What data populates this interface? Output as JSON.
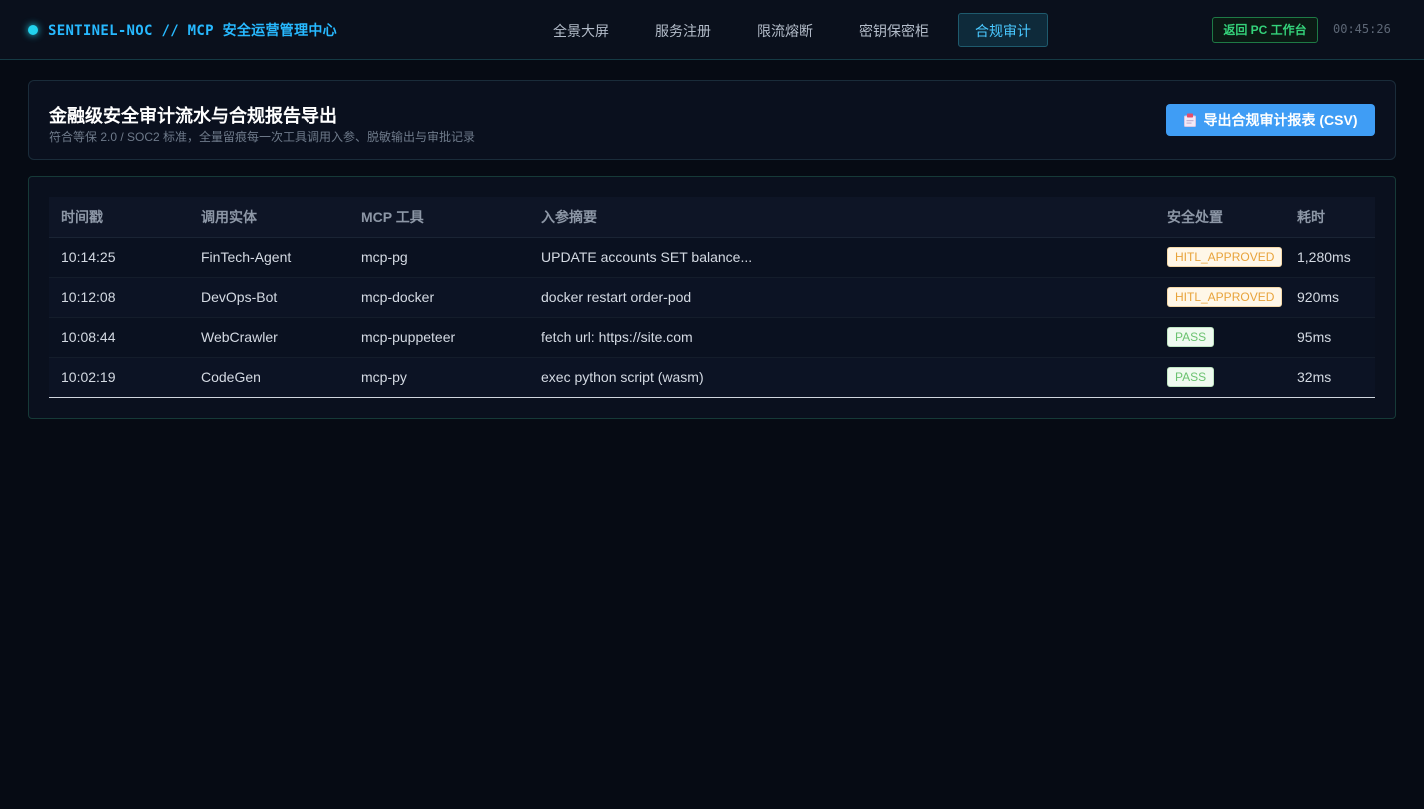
{
  "header": {
    "brand": "SENTINEL-NOC // MCP 安全运营管理中心",
    "nav": [
      "全景大屏",
      "服务注册",
      "限流熔断",
      "密钥保密柜",
      "合规审计"
    ],
    "active_tab": "合规审计",
    "back_button": "返回 PC 工作台",
    "clock": "00:45:26"
  },
  "page": {
    "title": "金融级安全审计流水与合规报告导出",
    "subtitle": "符合等保 2.0 / SOC2 标准，全量留痕每一次工具调用入参、脱敏输出与审批记录",
    "export_button": "导出合规审计报表 (CSV)"
  },
  "table": {
    "columns": [
      "时间戳",
      "调用实体",
      "MCP 工具",
      "入参摘要",
      "安全处置",
      "耗时"
    ],
    "rows": [
      [
        "10:14:25",
        "FinTech-Agent",
        "mcp-pg",
        "UPDATE accounts SET balance...",
        "HITL_APPROVED",
        "1,280ms"
      ],
      [
        "10:12:08",
        "DevOps-Bot",
        "mcp-docker",
        "docker restart order-pod",
        "HITL_APPROVED",
        "920ms"
      ],
      [
        "10:08:44",
        "WebCrawler",
        "mcp-puppeteer",
        "fetch url: https://site.com",
        "PASS",
        "95ms"
      ],
      [
        "10:02:19",
        "CodeGen",
        "mcp-py",
        "exec python script (wasm)",
        "PASS",
        "32ms"
      ]
    ]
  },
  "colors": {
    "accent": "#27b9ff",
    "export_button": "#3f9df5",
    "hitl": "#e8a33a",
    "pass": "#6ac26f"
  }
}
